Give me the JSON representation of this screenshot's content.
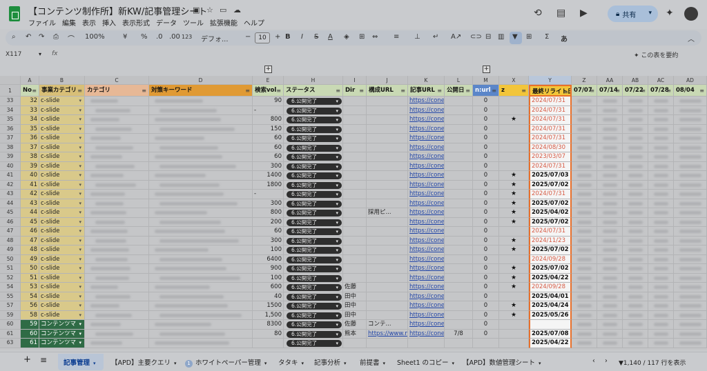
{
  "title": "【コンテンツ制作所】新KW/記事管理シート",
  "menu": [
    "ファイル",
    "編集",
    "表示",
    "挿入",
    "表示形式",
    "データ",
    "ツール",
    "拡張機能",
    "ヘルプ"
  ],
  "share_label": "共有",
  "toolbar": {
    "zoom": "100%",
    "currency": "¥",
    "percent": "%",
    "decimals_down": ".0",
    "decimals_up": ".00",
    "number_format": "123",
    "font": "デフォ...",
    "font_size": "10",
    "bold": "B",
    "sigma": "Σ",
    "input_tools": "あ"
  },
  "name_box": "X117",
  "fx": "fx",
  "summarize_label": "この表を要約",
  "columns": {
    "letters": [
      "A",
      "B",
      "C",
      "D",
      "E",
      "H",
      "I",
      "J",
      "K",
      "L",
      "M",
      "X",
      "Y",
      "Z",
      "AA",
      "AB",
      "AC",
      "AD"
    ],
    "headers": [
      "No",
      "事業カテゴリ",
      "カテゴリ",
      "対策キーワード",
      "検索vol",
      "ステータス",
      "Dir",
      "構成URL",
      "記事URL",
      "公開日",
      "n:url",
      "z",
      "最終リライト日",
      "07/07",
      "07/14",
      "07/22",
      "07/28",
      "08/04"
    ]
  },
  "header_row_num": "1",
  "rows": [
    {
      "r": "33",
      "no": "32",
      "cat": "c-slide",
      "vol": "90",
      "status": "6.公開完了",
      "dir": "",
      "kousei": "",
      "url": "https://cone-c",
      "pub": "",
      "n": "0",
      "z": "",
      "date": "2024/07/31",
      "red": true
    },
    {
      "r": "34",
      "no": "33",
      "cat": "c-slide",
      "vol": "-",
      "status": "6.公開完了",
      "dir": "",
      "kousei": "",
      "url": "https://cone-c",
      "pub": "",
      "n": "0",
      "z": "",
      "date": "2024/07/31",
      "red": true
    },
    {
      "r": "35",
      "no": "34",
      "cat": "c-slide",
      "vol": "800",
      "status": "6.公開完了",
      "dir": "",
      "kousei": "",
      "url": "https://cone-c",
      "pub": "",
      "n": "0",
      "z": "★",
      "date": "2024/07/31",
      "red": true
    },
    {
      "r": "36",
      "no": "35",
      "cat": "c-slide",
      "vol": "150",
      "status": "6.公開完了",
      "dir": "",
      "kousei": "",
      "url": "https://cone-c",
      "pub": "",
      "n": "0",
      "z": "",
      "date": "2024/07/31",
      "red": true
    },
    {
      "r": "37",
      "no": "36",
      "cat": "c-slide",
      "vol": "60",
      "status": "6.公開完了",
      "dir": "",
      "kousei": "",
      "url": "https://cone-c",
      "pub": "",
      "n": "0",
      "z": "",
      "date": "2024/07/31",
      "red": true
    },
    {
      "r": "38",
      "no": "37",
      "cat": "c-slide",
      "vol": "60",
      "status": "6.公開完了",
      "dir": "",
      "kousei": "",
      "url": "https://cone-c",
      "pub": "",
      "n": "0",
      "z": "",
      "date": "2024/08/30",
      "red": true
    },
    {
      "r": "39",
      "no": "38",
      "cat": "c-slide",
      "vol": "60",
      "status": "6.公開完了",
      "dir": "",
      "kousei": "",
      "url": "https://cone-c",
      "pub": "",
      "n": "0",
      "z": "",
      "date": "2023/03/07",
      "red": true
    },
    {
      "r": "40",
      "no": "39",
      "cat": "c-slide",
      "vol": "300",
      "status": "6.公開完了",
      "dir": "",
      "kousei": "",
      "url": "https://cone-c",
      "pub": "",
      "n": "0",
      "z": "",
      "date": "2024/07/31",
      "red": true
    },
    {
      "r": "41",
      "no": "40",
      "cat": "c-slide",
      "vol": "1400",
      "status": "6.公開完了",
      "dir": "",
      "kousei": "",
      "url": "https://cone-c",
      "pub": "",
      "n": "0",
      "z": "★",
      "date": "2025/07/03",
      "red": false
    },
    {
      "r": "42",
      "no": "41",
      "cat": "c-slide",
      "vol": "1800",
      "status": "6.公開完了",
      "dir": "",
      "kousei": "",
      "url": "https://cone-c",
      "pub": "",
      "n": "0",
      "z": "★",
      "date": "2025/07/02",
      "red": false
    },
    {
      "r": "43",
      "no": "42",
      "cat": "c-slide",
      "vol": "-",
      "status": "6.公開完了",
      "dir": "",
      "kousei": "",
      "url": "https://cone-c",
      "pub": "",
      "n": "0",
      "z": "★",
      "date": "2024/07/31",
      "red": true
    },
    {
      "r": "44",
      "no": "43",
      "cat": "c-slide",
      "vol": "300",
      "status": "6.公開完了",
      "dir": "",
      "kousei": "",
      "url": "https://cone-c",
      "pub": "",
      "n": "0",
      "z": "★",
      "date": "2025/07/02",
      "red": false
    },
    {
      "r": "45",
      "no": "44",
      "cat": "c-slide",
      "vol": "800",
      "status": "6.公開完了",
      "dir": "",
      "kousei": "採用ピ...",
      "url": "https://cone-c",
      "pub": "",
      "n": "0",
      "z": "★",
      "date": "2025/04/02",
      "red": false
    },
    {
      "r": "46",
      "no": "45",
      "cat": "c-slide",
      "vol": "200",
      "status": "6.公開完了",
      "dir": "",
      "kousei": "",
      "url": "https://cone-c",
      "pub": "",
      "n": "0",
      "z": "★",
      "date": "2025/07/02",
      "red": false
    },
    {
      "r": "47",
      "no": "46",
      "cat": "c-slide",
      "vol": "60",
      "status": "6.公開完了",
      "dir": "",
      "kousei": "",
      "url": "https://cone-c",
      "pub": "",
      "n": "0",
      "z": "",
      "date": "2024/07/31",
      "red": true
    },
    {
      "r": "48",
      "no": "47",
      "cat": "c-slide",
      "vol": "300",
      "status": "6.公開完了",
      "dir": "",
      "kousei": "",
      "url": "https://cone-c",
      "pub": "",
      "n": "0",
      "z": "★",
      "date": "2024/11/23",
      "red": true
    },
    {
      "r": "49",
      "no": "48",
      "cat": "c-slide",
      "vol": "100",
      "status": "6.公開完了",
      "dir": "",
      "kousei": "",
      "url": "https://cone-c",
      "pub": "",
      "n": "0",
      "z": "★",
      "date": "2025/07/02",
      "red": false
    },
    {
      "r": "50",
      "no": "49",
      "cat": "c-slide",
      "vol": "6400",
      "status": "6.公開完了",
      "dir": "",
      "kousei": "",
      "url": "https://cone-c",
      "pub": "",
      "n": "0",
      "z": "",
      "date": "2024/09/28",
      "red": true
    },
    {
      "r": "51",
      "no": "50",
      "cat": "c-slide",
      "vol": "900",
      "status": "6.公開完了",
      "dir": "",
      "kousei": "",
      "url": "https://cone-c",
      "pub": "",
      "n": "0",
      "z": "★",
      "date": "2025/07/02",
      "red": false
    },
    {
      "r": "52",
      "no": "51",
      "cat": "c-slide",
      "vol": "100",
      "status": "6.公開完了",
      "dir": "",
      "kousei": "",
      "url": "https://cone-c",
      "pub": "",
      "n": "0",
      "z": "★",
      "date": "2025/04/22",
      "red": false
    },
    {
      "r": "54",
      "no": "53",
      "cat": "c-slide",
      "vol": "600",
      "status": "6.公開完了",
      "dir": "佐藤",
      "kousei": "",
      "url": "https://cone-c",
      "pub": "",
      "n": "0",
      "z": "★",
      "date": "2024/09/28",
      "red": true
    },
    {
      "r": "55",
      "no": "54",
      "cat": "c-slide",
      "vol": "40",
      "status": "6.公開完了",
      "dir": "田中",
      "kousei": "",
      "url": "https://cone-c",
      "pub": "",
      "n": "0",
      "z": "",
      "date": "2025/04/01",
      "red": false
    },
    {
      "r": "57",
      "no": "56",
      "cat": "c-slide",
      "vol": "1500",
      "status": "6.公開完了",
      "dir": "田中",
      "kousei": "",
      "url": "https://cone-c",
      "pub": "",
      "n": "0",
      "z": "★",
      "date": "2025/04/24",
      "red": false
    },
    {
      "r": "59",
      "no": "58",
      "cat": "c-slide",
      "vol": "1,500",
      "status": "6.公開完了",
      "dir": "田中",
      "kousei": "",
      "url": "https://cone-c",
      "pub": "",
      "n": "0",
      "z": "★",
      "date": "2025/05/26",
      "red": false
    },
    {
      "r": "60",
      "no": "59",
      "cat": "コンテンツマ",
      "vol": "8300",
      "status": "6.公開完了",
      "dir": "佐藤",
      "kousei": "コンテ...",
      "url": "https://cone-c",
      "pub": "",
      "n": "0",
      "z": "",
      "date": "",
      "red": false,
      "green": true
    },
    {
      "r": "61",
      "no": "60",
      "cat": "コンテンツマ",
      "vol": "80",
      "status": "6.公開完了",
      "dir": "熊本",
      "kousei": "https://www.not",
      "url": "https://cone-c",
      "pub": "7/8",
      "n": "0",
      "z": "",
      "date": "2025/07/08",
      "red": false,
      "green": true
    },
    {
      "r": "63",
      "no": "61",
      "cat": "コンテンツマ",
      "vol": "",
      "status": "6.公開完了",
      "dir": "",
      "kousei": "",
      "url": "",
      "pub": "",
      "n": "",
      "z": "",
      "date": "2025/04/22",
      "red": false,
      "green": true
    }
  ],
  "tabs": [
    "記事管理",
    "【APD】主要クエリ",
    "ホワイトペーパー管理",
    "タタキ",
    "記事分析",
    "前提書",
    "Sheet1 のコピー",
    "【APD】数値管理シート"
  ],
  "tab_badge": "1",
  "stats": "1,140 / 117 行を表示",
  "colors": {
    "header_green": "#c9d9b4",
    "header_orange": "#e09a34",
    "header_blue": "#5b86c9",
    "header_yellow": "#f2c53a",
    "cat_yellow": "#d9c98a",
    "cat_green": "#2f6b45",
    "date_red": "#d65b45"
  }
}
